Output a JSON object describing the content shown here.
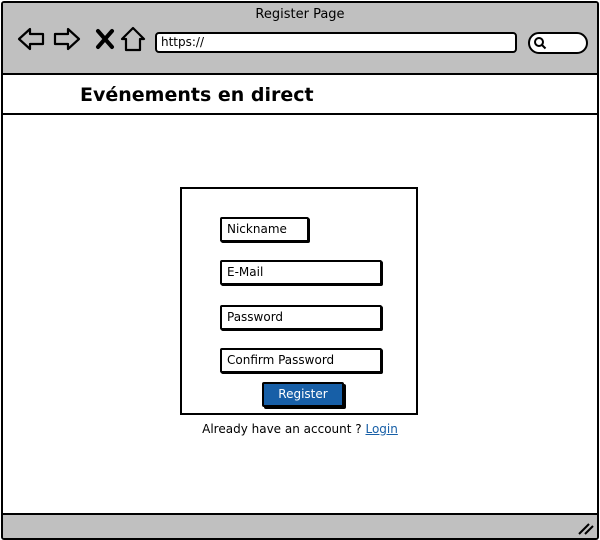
{
  "window": {
    "title": "Register Page"
  },
  "toolbar": {
    "icons": [
      "back-arrow-icon",
      "forward-arrow-icon",
      "close-icon",
      "home-icon"
    ],
    "url": "https://",
    "search_icon": "search-icon"
  },
  "header": {
    "site_title": "Evénements en direct"
  },
  "form": {
    "nickname_placeholder": "Nickname",
    "email_placeholder": "E-Mail",
    "password_placeholder": "Password",
    "confirm_password_placeholder": "Confirm Password",
    "register_label": "Register"
  },
  "footer_line": {
    "prompt": "Already have an account ?",
    "login_link": "Login"
  },
  "colors": {
    "chrome": "#c0c0c0",
    "accent": "#175fa7"
  }
}
